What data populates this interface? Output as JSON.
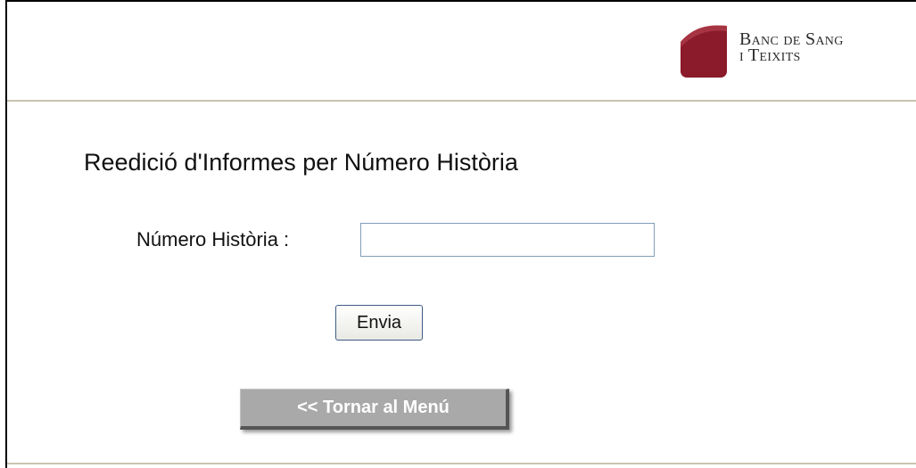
{
  "header": {
    "logo": {
      "line1": "Banc de Sang",
      "line2": "i Teixits",
      "brand_color": "#8b1a2b"
    }
  },
  "main": {
    "title": "Reedició d'Informes per Número Història",
    "form": {
      "field_label": "Número Història :",
      "field_value": "",
      "submit_label": "Envia"
    },
    "back_button_label": "<< Tornar al Menú"
  },
  "colors": {
    "rule": "#c9c3b0",
    "back_button_bg": "#a9a9a9",
    "input_border": "#7f9db9"
  }
}
